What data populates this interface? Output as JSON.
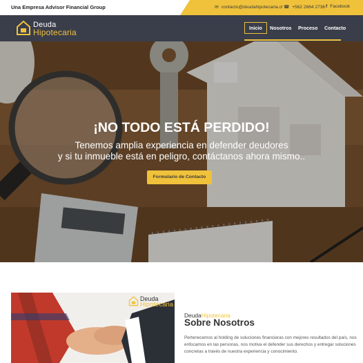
{
  "topbar": {
    "tagline": "Una Empresa Advisor Financial Group",
    "email": "contacto@deudahipotecaria.cl",
    "phone": "+562 2664 2736",
    "facebook": "Facebook",
    "accent_color": "#f0c23b",
    "icons": {
      "email": "envelope-icon",
      "phone": "phone-icon",
      "facebook": "facebook-icon"
    }
  },
  "brand": {
    "word1": "Deuda",
    "word2": "Hipotecaria",
    "logo_icon": "house-logo-icon"
  },
  "nav": {
    "background": "#3a3d4a",
    "items": [
      {
        "label": "Inicio",
        "active": true
      },
      {
        "label": "Nosotros",
        "active": false
      },
      {
        "label": "Proceso",
        "active": false
      },
      {
        "label": "Contacto",
        "active": false
      }
    ]
  },
  "hero": {
    "headline": "¡NO TODO ESTÁ PERDIDO!",
    "line1": "Tenemos amplia experiencia en defender deudores",
    "line2": "y si tu inmueble está en peligro, contáctanos ahora mismo..",
    "cta": "Formulario de Contacto"
  },
  "about": {
    "brand_prefix": "Deuda",
    "brand_highlight": "Hipotecaria",
    "title": "Sobre Nosotros",
    "text": "Pertenecemos al holding de soluciones financieras con mejores resultados del país, nos enfocamos en las personas, nos motiva el defender sus derechos y entregar soluciones concretas a través de nuestra experiencia y conocimiento."
  }
}
